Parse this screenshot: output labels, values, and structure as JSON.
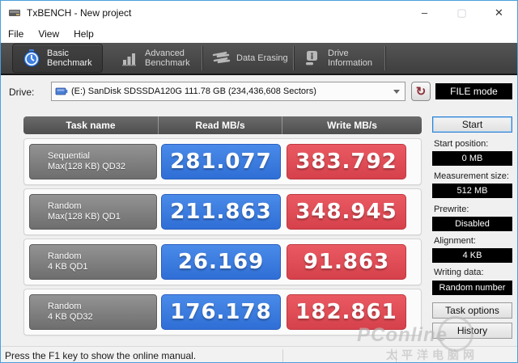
{
  "window": {
    "title": "TxBENCH - New project"
  },
  "menu": {
    "file": "File",
    "view": "View",
    "help": "Help"
  },
  "tabs": {
    "basic": {
      "line1": "Basic",
      "line2": "Benchmark"
    },
    "advanced": {
      "line1": "Advanced",
      "line2": "Benchmark"
    },
    "erasing": {
      "line1": "Data Erasing",
      "line2": ""
    },
    "driveinfo": {
      "line1": "Drive",
      "line2": "Information"
    }
  },
  "drive": {
    "label": "Drive:",
    "selected": "(E:) SanDisk SDSSDA120G  111.78 GB (234,436,608 Sectors)"
  },
  "controls": {
    "file_mode": "FILE mode",
    "start": "Start",
    "task_options": "Task options",
    "history": "History",
    "refresh_glyph": "↻",
    "minimize_glyph": "–",
    "maximize_glyph": "▢",
    "close_glyph": "✕"
  },
  "table": {
    "headers": {
      "task": "Task name",
      "read": "Read MB/s",
      "write": "Write MB/s"
    },
    "rows": [
      {
        "line1": "Sequential",
        "line2": "Max(128 KB) QD32",
        "read": "281.077",
        "write": "383.792"
      },
      {
        "line1": "Random",
        "line2": "Max(128 KB) QD1",
        "read": "211.863",
        "write": "348.945"
      },
      {
        "line1": "Random",
        "line2": "4 KB QD1",
        "read": "26.169",
        "write": "91.863"
      },
      {
        "line1": "Random",
        "line2": "4 KB QD32",
        "read": "176.178",
        "write": "182.861"
      }
    ]
  },
  "settings": [
    {
      "label": "Start position:",
      "value": "0 MB"
    },
    {
      "label": "Measurement size:",
      "value": "512 MB"
    },
    {
      "label": "Prewrite:",
      "value": "Disabled"
    },
    {
      "label": "Alignment:",
      "value": "4 KB"
    },
    {
      "label": "Writing data:",
      "value": "Random number"
    }
  ],
  "statusbar": {
    "text": "Press the F1 key to show the online manual."
  },
  "watermark": {
    "brand": "PConline",
    "caption": "太平洋电脑网"
  },
  "colors": {
    "read_box_blue": "#3a7de4",
    "write_box_red": "#e2505a",
    "task_box_gray": "#7d7d7d",
    "tabbar_dark": "#474747",
    "window_border_blue": "#4aa0dc",
    "value_box_black": "#000000"
  }
}
